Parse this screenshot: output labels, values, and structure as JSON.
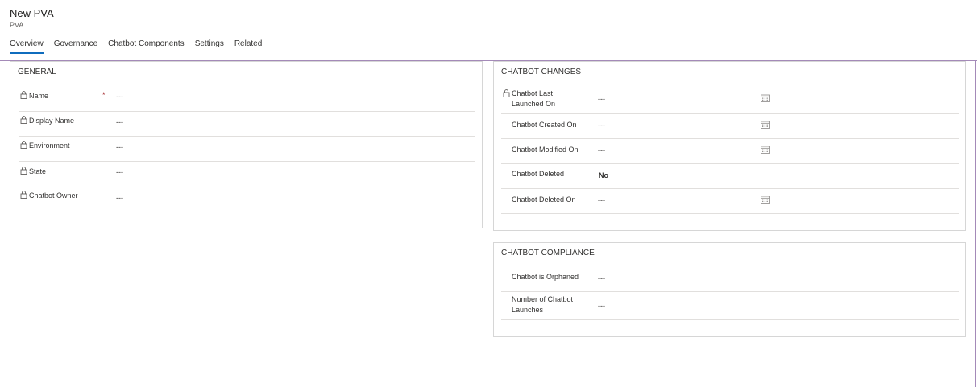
{
  "header": {
    "title": "New PVA",
    "subtitle": "PVA"
  },
  "tabs": [
    {
      "label": "Overview",
      "active": true
    },
    {
      "label": "Governance"
    },
    {
      "label": "Chatbot Components"
    },
    {
      "label": "Settings"
    },
    {
      "label": "Related"
    }
  ],
  "general": {
    "title": "GENERAL",
    "fields": [
      {
        "label": "Name",
        "value": "---",
        "required_mark": "*"
      },
      {
        "label": "Display Name",
        "value": "---"
      },
      {
        "label": "Environment",
        "value": "---"
      },
      {
        "label": "State",
        "value": "---"
      },
      {
        "label": "Chatbot Owner",
        "value": "---"
      }
    ]
  },
  "changes": {
    "title": "CHATBOT CHANGES",
    "fields": [
      {
        "label_line1": "Chatbot Last",
        "label_line2": "Launched On",
        "value": "---"
      },
      {
        "label": "Chatbot Created On",
        "value": "---"
      },
      {
        "label": "Chatbot Modified On",
        "value": "---"
      },
      {
        "label": "Chatbot Deleted",
        "value": "No"
      },
      {
        "label": "Chatbot Deleted On",
        "value": "---"
      }
    ]
  },
  "compliance": {
    "title": "CHATBOT COMPLIANCE",
    "fields": [
      {
        "label": "Chatbot is Orphaned",
        "value": "---"
      },
      {
        "label_line1": "Number of Chatbot",
        "label_line2": "Launches",
        "value": "---"
      }
    ]
  },
  "icons": {
    "lock": "lock-icon",
    "calendar": "calendar-icon"
  }
}
